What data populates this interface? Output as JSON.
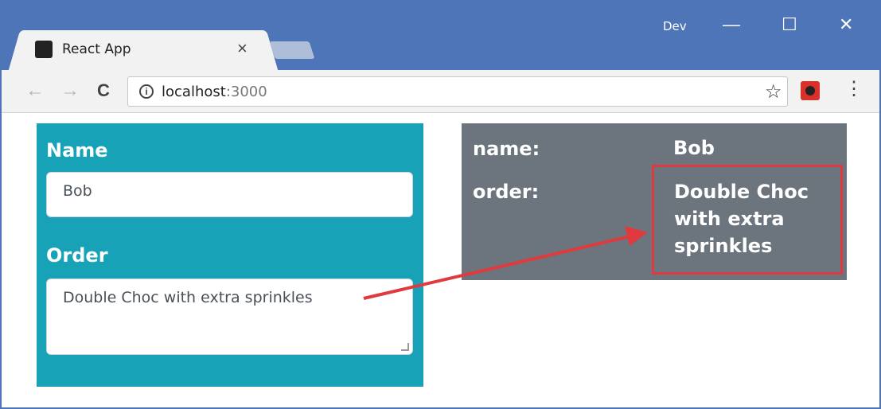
{
  "browser": {
    "tab_title": "React App",
    "tab_close": "×",
    "profile_name": "Dev",
    "minimize": "—",
    "maximize": "☐",
    "close": "✕",
    "back": "←",
    "forward": "→",
    "reload": "C",
    "info": "i",
    "url_host": "localhost",
    "url_port": ":3000",
    "star": "☆",
    "menu": "⋮"
  },
  "form": {
    "name_label": "Name",
    "name_value": "Bob",
    "order_label": "Order",
    "order_value": "Double Choc with extra sprinkles"
  },
  "summary": {
    "name_key": "name:",
    "name_value": "Bob",
    "order_key": "order:",
    "order_value": "Double Choc with extra sprinkles"
  },
  "colors": {
    "window_frame": "#4f75b9",
    "form_panel": "#17a2b8",
    "summary_panel": "#6c757d",
    "highlight": "#e03a3e"
  }
}
